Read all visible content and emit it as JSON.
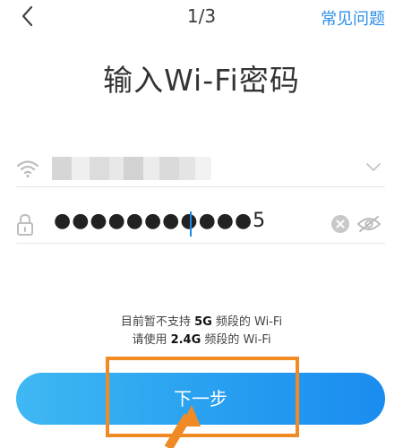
{
  "header": {
    "step": "1/3",
    "faq": "常见问题"
  },
  "page": {
    "title": "输入Wi-Fi密码"
  },
  "ssid": {
    "value_obscured": true
  },
  "password": {
    "masked": "●●●●●●●●●●●5"
  },
  "notice": {
    "line1_prefix": "目前暂不支持 ",
    "line1_band": "5G",
    "line1_suffix": " 频段的 Wi-Fi",
    "line2_prefix": "请使用 ",
    "line2_band": "2.4G",
    "line2_suffix": " 频段的 Wi-Fi"
  },
  "button": {
    "next": "下一步"
  },
  "colors": {
    "accent": "#2c8ee8",
    "button_start": "#3fb8f3",
    "button_end": "#1a8cf0",
    "highlight": "#f08a24"
  },
  "icons": {
    "back": "chevron-left-icon",
    "wifi": "wifi-icon",
    "dropdown": "chevron-down-icon",
    "lock": "lock-icon",
    "clear": "clear-icon",
    "eye": "eye-off-icon"
  }
}
